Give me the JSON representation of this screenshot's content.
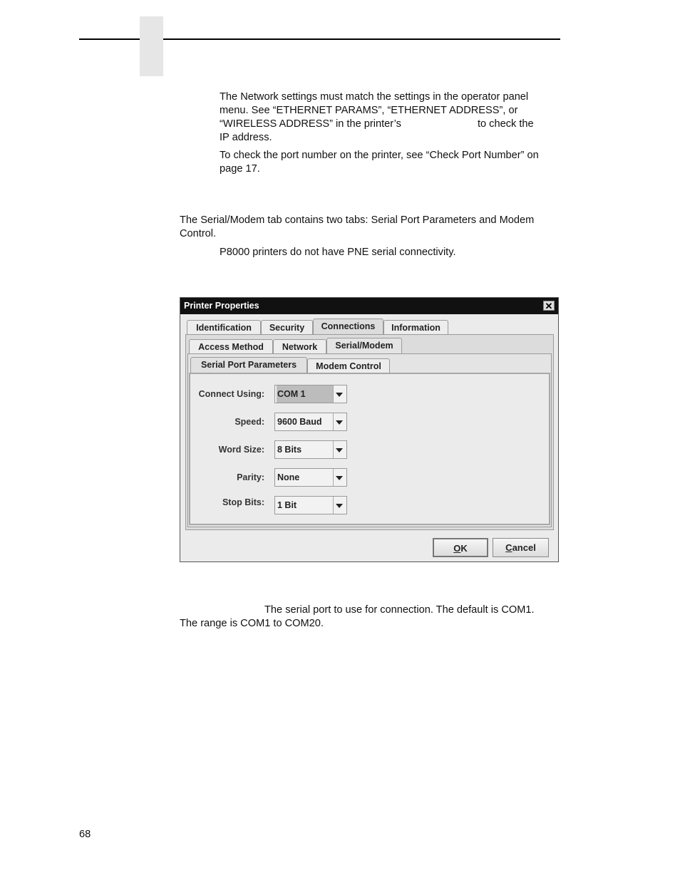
{
  "page": {
    "note1": {
      "line1": "The Network settings must match the settings in the operator panel",
      "line2": "menu. See “ETHERNET PARAMS”, “ETHERNET ADDRESS”, or",
      "line3a": "“WIRELESS ADDRESS” in the printer’s",
      "line3b": "to check the",
      "line4": "IP address."
    },
    "note2": {
      "line1": "To check the port number on the printer, see “Check Port Number” on",
      "line2": "page 17."
    },
    "body1": {
      "line1": "The Serial/Modem tab contains two tabs: Serial Port Parameters and Modem",
      "line2": "Control."
    },
    "note3": "P8000 printers do not have PNE serial connectivity.",
    "body2": {
      "line1": "The serial port to use for connection. The default is COM1.",
      "line2": "The range is COM1 to COM20."
    },
    "page_number": "68"
  },
  "dialog": {
    "title": "Printer Properties",
    "close_glyph": "✕",
    "tabs_level1": [
      "Identification",
      "Security",
      "Connections",
      "Information"
    ],
    "tabs_level1_selected": "Connections",
    "tabs_level2": [
      "Access Method",
      "Network",
      "Serial/Modem"
    ],
    "tabs_level2_selected": "Serial/Modem",
    "tabs_level3": [
      "Serial Port Parameters",
      "Modem Control"
    ],
    "tabs_level3_selected": "Serial Port Parameters",
    "fields": [
      {
        "label": "Connect Using:",
        "value": "COM 1"
      },
      {
        "label": "Speed:",
        "value": "9600 Baud"
      },
      {
        "label": "Word Size:",
        "value": "8 Bits"
      },
      {
        "label": "Parity:",
        "value": "None"
      },
      {
        "label": "Stop Bits:",
        "value": "1 Bit"
      }
    ],
    "buttons": {
      "ok": {
        "mnemonic": "O",
        "rest": "K"
      },
      "cancel": {
        "mnemonic": "C",
        "rest": "ancel"
      }
    }
  }
}
